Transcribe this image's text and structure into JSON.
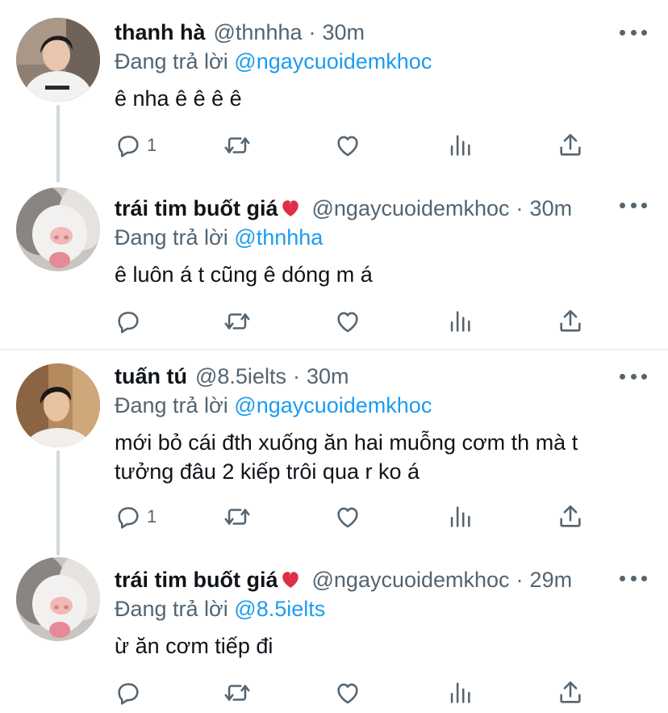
{
  "tweets": [
    {
      "name": "thanh hà",
      "handle": "@thnhha",
      "dot": "·",
      "time": "30m",
      "reply_prefix": "Đang trả lời",
      "reply_to": "@ngaycuoidemkhoc",
      "text": "ê nha ê ê ê ê",
      "reply_count": "1",
      "has_broken_heart": false
    },
    {
      "name": "trái tim buốt giá",
      "handle": "@ngaycuoidemkhoc",
      "dot": "·",
      "time": "30m",
      "reply_prefix": "Đang trả lời",
      "reply_to": "@thnhha",
      "text": "ê luôn á t cũng ê dóng m á",
      "reply_count": "",
      "has_broken_heart": true
    },
    {
      "name": "tuấn tú",
      "handle": "@8.5ielts",
      "dot": "·",
      "time": "30m",
      "reply_prefix": "Đang trả lời",
      "reply_to": "@ngaycuoidemkhoc",
      "text": "mới bỏ cái đth xuống ăn hai muỗng cơm th mà t\ntưởng đâu 2 kiếp trôi qua r ko á",
      "reply_count": "1",
      "has_broken_heart": false
    },
    {
      "name": "trái tim buốt giá",
      "handle": "@ngaycuoidemkhoc",
      "dot": "·",
      "time": "29m",
      "reply_prefix": "Đang trả lời",
      "reply_to": "@8.5ielts",
      "text": "ừ ăn cơm tiếp đi",
      "reply_count": "",
      "has_broken_heart": true
    }
  ],
  "icons": [
    "reply-icon",
    "retweet-icon",
    "like-icon",
    "analytics-icon",
    "share-icon",
    "more-icon",
    "broken-heart-emoji"
  ],
  "colors": {
    "text": "#0f1419",
    "muted": "#536471",
    "link": "#1d9bf0",
    "thread_line": "#cfd9de",
    "divider": "#eff3f4",
    "broken_heart": "#dd2e44"
  }
}
